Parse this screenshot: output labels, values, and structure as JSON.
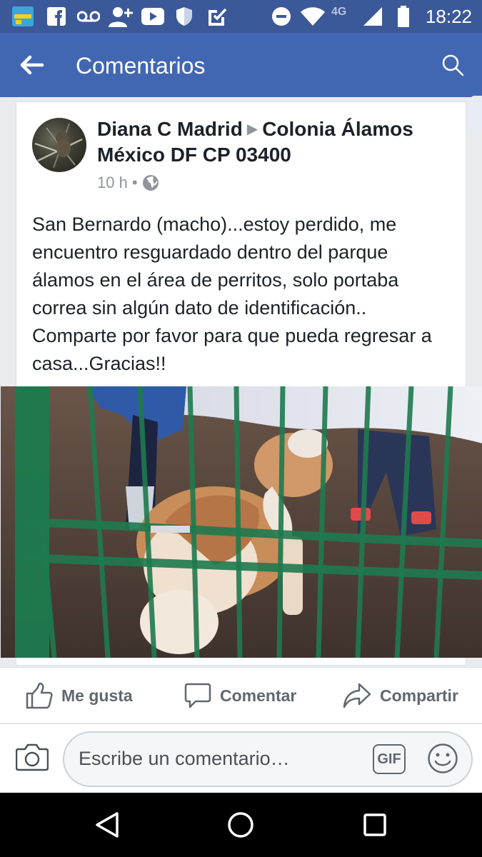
{
  "status_bar": {
    "time": "18:22",
    "network": "4G",
    "icons": [
      "game-app-icon",
      "facebook-icon",
      "voicemail-icon",
      "add-friend-icon",
      "youtube-icon",
      "shield-icon",
      "checkmark-icon",
      "do-not-disturb-icon",
      "wifi-icon",
      "signal-icon",
      "battery-icon"
    ]
  },
  "header": {
    "title": "Comentarios",
    "back_icon": "arrow-left-icon",
    "search_icon": "search-icon"
  },
  "post": {
    "author": "Diana C Madrid",
    "target": "Colonia Álamos México DF CP 03400",
    "time": "10 h",
    "separator": "•",
    "privacy_icon": "globe-icon",
    "text": "San Bernardo (macho)...estoy perdido, me encuentro resguardado dentro del parque álamos en el área de perritos, solo portaba correa sin algún dato de identificación.. Comparte por favor  para que pueda regresar a casa...Gracias!!"
  },
  "actions": {
    "like": "Me gusta",
    "comment": "Comentar",
    "share": "Compartir"
  },
  "comment_bar": {
    "placeholder": "Escribe un comentario…",
    "gif_label": "GIF"
  },
  "colors": {
    "brand": "#4267b2",
    "status_bar": "#3b5998",
    "text": "#1d2129",
    "meta": "#90949c",
    "action": "#616770"
  }
}
